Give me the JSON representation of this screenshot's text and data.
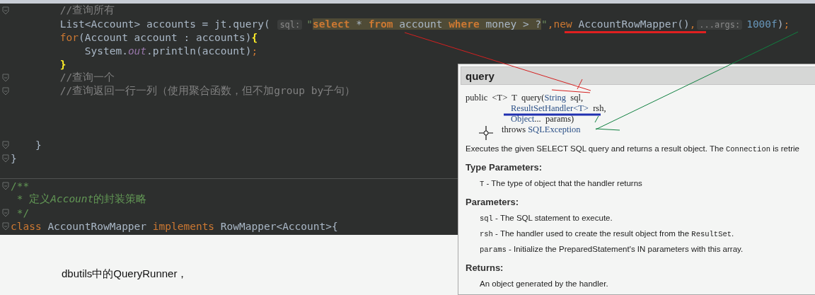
{
  "editor": {
    "lines": [
      {
        "fold": true,
        "tokens": [
          {
            "kind": "comment",
            "text": "        //查询所有"
          }
        ]
      },
      {
        "fold": false,
        "tokens": [
          {
            "kind": "plain",
            "text": "        List<Account> accounts = jt.query( "
          },
          {
            "kind": "hint",
            "text": "sql:"
          },
          {
            "kind": "string",
            "text": "\""
          },
          {
            "kind": "sqlkw",
            "text": "select"
          },
          {
            "kind": "sql",
            "text": " * "
          },
          {
            "kind": "sqlkw",
            "text": "from"
          },
          {
            "kind": "sql",
            "text": " account "
          },
          {
            "kind": "sqlkw",
            "text": "where"
          },
          {
            "kind": "sql",
            "text": " money > ?"
          },
          {
            "kind": "string",
            "text": "\""
          },
          {
            "kind": "keyword",
            "text": ",new"
          },
          {
            "kind": "plain",
            "text": " AccountRowMapper()"
          },
          {
            "kind": "keyword",
            "text": ","
          },
          {
            "kind": "hint",
            "text": "...args:"
          },
          {
            "kind": "number",
            "text": "1000f"
          },
          {
            "kind": "plain",
            "text": ")"
          },
          {
            "kind": "keyword",
            "text": ";"
          }
        ]
      },
      {
        "fold": false,
        "tokens": [
          {
            "kind": "keyword",
            "text": "        for"
          },
          {
            "kind": "plain",
            "text": "(Account account : accounts)"
          },
          {
            "kind": "brace",
            "text": "{"
          }
        ]
      },
      {
        "fold": false,
        "tokens": [
          {
            "kind": "plain",
            "text": "            System."
          },
          {
            "kind": "field",
            "text": "out"
          },
          {
            "kind": "plain",
            "text": ".println(account)"
          },
          {
            "kind": "keyword",
            "text": ";"
          }
        ]
      },
      {
        "fold": false,
        "tokens": [
          {
            "kind": "brace",
            "text": "        }"
          }
        ]
      },
      {
        "fold": true,
        "tokens": [
          {
            "kind": "comment",
            "text": "        //查询一个"
          }
        ]
      },
      {
        "fold": true,
        "tokens": [
          {
            "kind": "comment",
            "text": "        //查询返回一行一列（使用聚合函数，但不加group by子句）"
          }
        ]
      },
      {
        "fold": false
      },
      {
        "fold": false
      },
      {
        "fold": false
      },
      {
        "fold": true,
        "tokens": [
          {
            "kind": "plain",
            "text": "    }"
          }
        ]
      },
      {
        "fold": true,
        "tokens": [
          {
            "kind": "plain",
            "text": "}"
          }
        ]
      },
      {
        "fold": false
      },
      {
        "fold": true,
        "separator": true,
        "tokens": [
          {
            "kind": "doc",
            "text": "/**"
          }
        ]
      },
      {
        "fold": false,
        "tokens": [
          {
            "kind": "doc",
            "text": " * 定义"
          },
          {
            "kind": "docitalic",
            "text": "Account"
          },
          {
            "kind": "doc",
            "text": "的封装策略"
          }
        ]
      },
      {
        "fold": true,
        "tokens": [
          {
            "kind": "doc",
            "text": " */"
          }
        ]
      },
      {
        "fold": true,
        "tokens": [
          {
            "kind": "keyword",
            "text": "class"
          },
          {
            "kind": "plain",
            "text": " AccountRowMapper "
          },
          {
            "kind": "keyword",
            "text": "implements"
          },
          {
            "kind": "plain",
            "text": " RowMapper<Account>{"
          }
        ]
      }
    ]
  },
  "note": "dbutils中的QueryRunner，",
  "doc_popup": {
    "title": "query",
    "signature": [
      {
        "kind": "head",
        "tokens": [
          {
            "kind": "plain",
            "text": "public  <T>  T  query("
          },
          {
            "kind": "type",
            "text": "String"
          },
          {
            "kind": "plain",
            "text": "  sql,"
          }
        ]
      },
      {
        "kind": "param",
        "tokens": [
          {
            "kind": "type",
            "text": "ResultSetHandler<T>"
          },
          {
            "kind": "plain",
            "text": "  rsh,"
          }
        ]
      },
      {
        "kind": "param",
        "tokens": [
          {
            "kind": "type",
            "text": "Object"
          },
          {
            "kind": "plain",
            "text": "...  params)"
          }
        ]
      },
      {
        "kind": "throws",
        "tokens": [
          {
            "kind": "plain",
            "text": "throws "
          },
          {
            "kind": "type",
            "text": "SQLException"
          }
        ]
      }
    ],
    "description": [
      {
        "kind": "text",
        "text": "Executes the given SELECT SQL query and returns a result object. The "
      },
      {
        "kind": "code",
        "text": "Connection"
      },
      {
        "kind": "text",
        "text": " is retrie"
      }
    ],
    "sections": [
      {
        "heading": "Type Parameters:",
        "items": [
          [
            {
              "kind": "code",
              "text": "T"
            },
            {
              "kind": "text",
              "text": " - The type of object that the handler returns"
            }
          ]
        ]
      },
      {
        "heading": "Parameters:",
        "items": [
          [
            {
              "kind": "code",
              "text": "sql"
            },
            {
              "kind": "text",
              "text": " - The SQL statement to execute."
            }
          ],
          [
            {
              "kind": "code",
              "text": "rsh"
            },
            {
              "kind": "text",
              "text": " - The handler used to create the result object from the "
            },
            {
              "kind": "code",
              "text": "ResultSet"
            },
            {
              "kind": "text",
              "text": "."
            }
          ],
          [
            {
              "kind": "code",
              "text": "params"
            },
            {
              "kind": "text",
              "text": " - Initialize the PreparedStatement's IN parameters with this array."
            }
          ]
        ]
      },
      {
        "heading": "Returns:",
        "items": [
          [
            {
              "kind": "text",
              "text": "An object generated by the handler."
            }
          ]
        ]
      }
    ]
  }
}
